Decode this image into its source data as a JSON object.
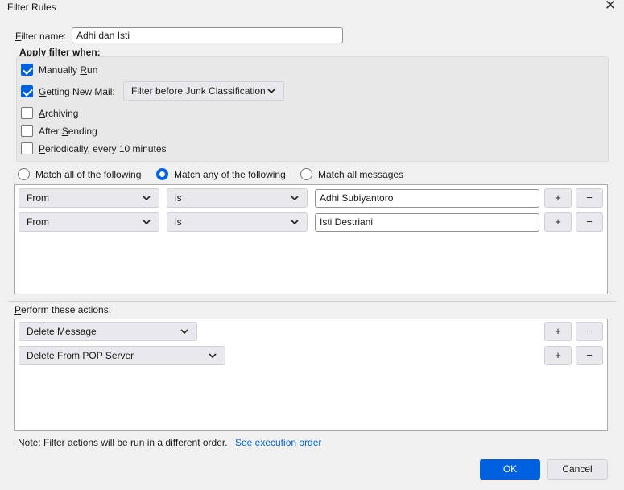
{
  "window": {
    "title": "Filter Rules",
    "close_glyph": "✕"
  },
  "filter_name": {
    "label_prefix": "F",
    "label_rest": "ilter name:",
    "value": "Adhi dan Isti"
  },
  "apply": {
    "title": "Apply filter when:",
    "manual": {
      "checked": true,
      "pre": "Manually ",
      "key": "R",
      "post": "un"
    },
    "new_mail": {
      "checked": true,
      "pre": "",
      "key": "G",
      "post": "etting New Mail:",
      "dropdown": "Filter before Junk Classification"
    },
    "archiving": {
      "checked": false,
      "pre": "",
      "key": "A",
      "post": "rchiving"
    },
    "after_sending": {
      "checked": false,
      "pre": "After ",
      "key": "S",
      "post": "ending"
    },
    "periodically": {
      "checked": false,
      "pre": "",
      "key": "P",
      "post": "eriodically, every 10 minutes"
    }
  },
  "match": {
    "all": {
      "pre": "",
      "key": "M",
      "post": "atch all of the following",
      "selected": false
    },
    "any": {
      "pre": "Match any ",
      "key": "o",
      "post": "f the following",
      "selected": true
    },
    "all_messages": {
      "pre": "Match all ",
      "key": "m",
      "post": "essages",
      "selected": false
    }
  },
  "rules": [
    {
      "field": "From",
      "operator": "is",
      "value": "Adhi Subiyantoro"
    },
    {
      "field": "From",
      "operator": "is",
      "value": "Isti Destriani"
    }
  ],
  "actions_label": {
    "key": "P",
    "rest": "erform these actions:"
  },
  "actions": [
    {
      "action": "Delete Message"
    },
    {
      "action": "Delete From POP Server"
    }
  ],
  "buttons": {
    "plus": "+",
    "minus": "−",
    "ok": "OK",
    "cancel": "Cancel"
  },
  "note": {
    "text": "Note: Filter actions will be run in a different order.",
    "link": "See execution order"
  },
  "colors": {
    "accent": "#0061e0",
    "dialog_bg": "#f0f0f0"
  },
  "icons": [
    "close-icon",
    "chevron-down-icon",
    "checkmark-icon"
  ]
}
